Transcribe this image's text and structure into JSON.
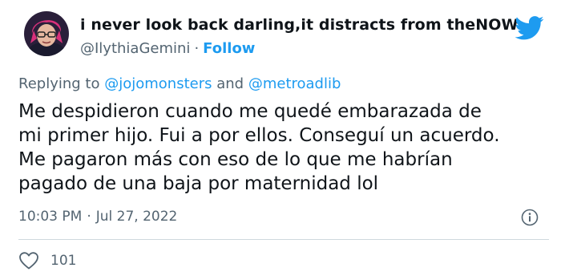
{
  "tweet": {
    "display_name": "i never look back darling,it distracts from theNOW",
    "handle": "@IlythiaGemini",
    "separator": "·",
    "follow_label": "Follow",
    "replying": {
      "prefix": "Replying to",
      "mention1": "@jojomonsters",
      "connector": "and",
      "mention2": "@metroadlib"
    },
    "text_lines": [
      "Me despidieron cuando me quedé embarazada de",
      "mi primer hijo. Fui a por ellos. Conseguí un acuerdo.",
      "Me pagaron más con eso de lo que me habrían",
      "pagado de una baja por maternidad lol"
    ],
    "time": "10:03 PM",
    "date": "Jul 27, 2022",
    "like_count": "101"
  },
  "icons": {
    "platform": "twitter-bird-icon",
    "info": "info-icon",
    "like": "heart-icon"
  },
  "colors": {
    "accent": "#1d9bf0",
    "text": "#0f1419",
    "secondary": "#536471",
    "divider": "#cfd9de"
  }
}
